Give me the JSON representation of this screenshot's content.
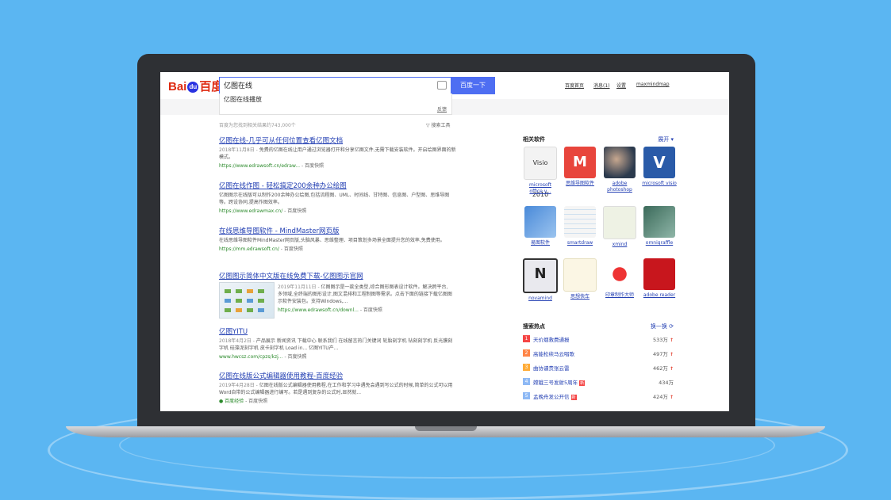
{
  "browser": {
    "logo_left": "Bai",
    "logo_paw": "du",
    "logo_right": "百度",
    "query": "亿图在线",
    "search_button": "百度一下",
    "suggestion": "亿图在线播放",
    "feedback": "反馈",
    "nav": {
      "home": "百度首页",
      "messages": "消息(1)",
      "settings": "设置",
      "user": "maxmindmap"
    },
    "result_count": "百度为您找到相关结果约743,000个",
    "search_tools": "搜索工具"
  },
  "results": [
    {
      "title": "亿图在线-几乎可从任何位置查看亿图文档",
      "date": "2018年11月8日 -",
      "desc": "免费的亿图在线让用户通过浏览器打开和分享亿图文件,无需下载安装软件。开启绘图界面的新模式。",
      "url": "https://www.edrawsoft.cn/edraw... ",
      "cache": "- 百度快照"
    },
    {
      "title": "亿图在线作图 - 轻松搞定200余种办公绘图",
      "date": "",
      "desc": "亿图图示在线版可以制作200余种办公绘图,包括流程图、UML、时间线、甘特图、信息图、户型图、思维导图等。跨设协同,提高作图效率。",
      "url": "https://www.edrawmax.cn/ ",
      "cache": "- 百度快照"
    },
    {
      "title": "在线思维导图软件 - MindMaster网页版",
      "date": "",
      "desc": "在线思维导图软件MindMaster网页版,头脑风暴、思维整理、项目策划多场景全面提升您的效率,免费使用。",
      "url": "https://mm.edrawsoft.cn/ ",
      "cache": "- 百度快照"
    },
    {
      "title": "亿图图示简体中文版在线免费下载-亿图图示官网",
      "date": "2019年11月11日 -",
      "desc": "亿图图示是一款全类型,综合图形图表设计软件。解决跨平台,多领域,全终端的图形设计,图文混排和工程制图等需求。点击下面的链接下载亿图图示软件安装包。支持Windows,...",
      "url": "https://www.edrawsoft.cn/downl... ",
      "cache": "- 百度快照"
    },
    {
      "title": "亿图YITU",
      "date": "2018年4月2日 -",
      "desc": "产品展示 新闻资讯 下载中心 联系我们 在线留言热门关键词 轮胎刻字机 钻刻刻字机 反光膜刻字机 硅藻泥刻字机 皮卡刻字机 Load in... 亿图YITU产...",
      "url": "www.hwcsz.com/cpzs/kzj... ",
      "cache": "- 百度快照"
    },
    {
      "title": "亿图在线版公式编辑器使用教程-百度经验",
      "date": "2019年4月28日 -",
      "desc": "亿图在线版公式编辑器使用教程,在工作和学习中遇免会遇到写公式的时候,简单的公式可以用Word自带的公式编辑器进行编写。若是遇到复杂的公式时,显然就...",
      "url": "百度经验 ",
      "cache": "- 百度快照"
    }
  ],
  "sidebar": {
    "related_title": "相关软件",
    "expand": "展开",
    "apps": [
      {
        "name": "microsoft office v...",
        "icon_text": "Visio 2010"
      },
      {
        "name": "思维导图软件",
        "icon_text": "M"
      },
      {
        "name": "adobe photoshop",
        "icon_text": ""
      },
      {
        "name": "microsoft visio",
        "icon_text": "V"
      },
      {
        "name": "易图软件",
        "icon_text": ""
      },
      {
        "name": "smartdraw",
        "icon_text": ""
      },
      {
        "name": "xmind",
        "icon_text": ""
      },
      {
        "name": "omnigraffle",
        "icon_text": ""
      },
      {
        "name": "novamind",
        "icon_text": "N"
      },
      {
        "name": "思想快车",
        "icon_text": ""
      },
      {
        "name": "印章制作大师",
        "icon_text": ""
      },
      {
        "name": "adobe reader",
        "icon_text": ""
      }
    ],
    "hot_title": "搜索热点",
    "refresh": "换一换",
    "hot": [
      {
        "rank": "1",
        "text": "天价烟救费通报",
        "value": "533万",
        "color": "#f54545",
        "tag": ""
      },
      {
        "rank": "2",
        "text": "高能松续马云唱歌",
        "value": "497万",
        "color": "#ff8547",
        "tag": ""
      },
      {
        "rank": "3",
        "text": "曲协谴责张云雷",
        "value": "462万",
        "color": "#ffac38",
        "tag": ""
      },
      {
        "rank": "4",
        "text": "嫦娥三号发射5周年",
        "value": "434万",
        "color": "#8eb9f5",
        "tag": "新"
      },
      {
        "rank": "5",
        "text": "孟晚舟发公开信",
        "value": "424万",
        "color": "#8eb9f5",
        "tag": "新"
      }
    ]
  }
}
